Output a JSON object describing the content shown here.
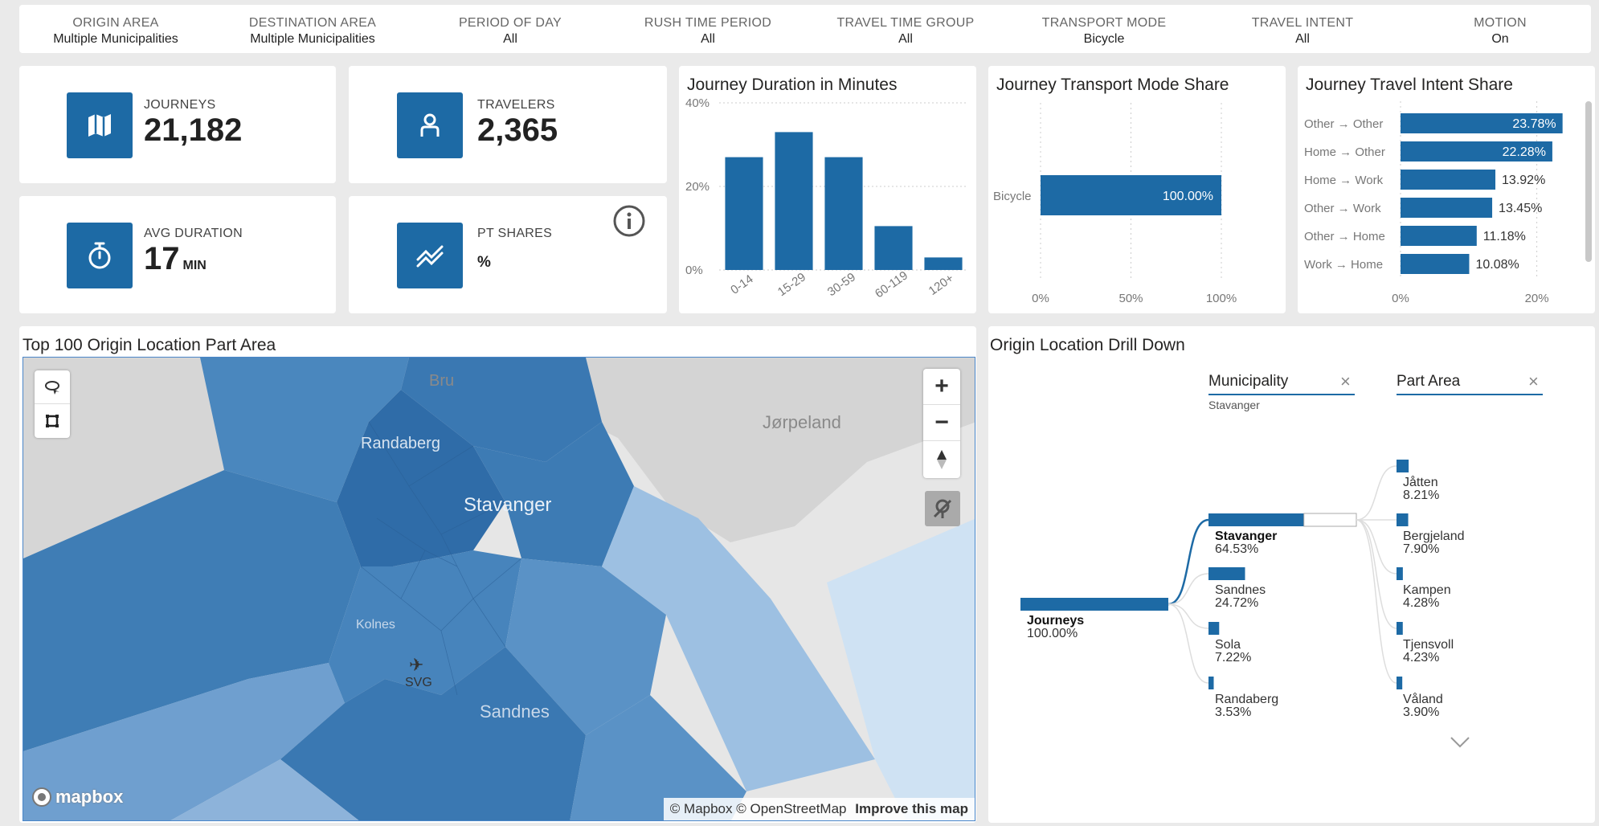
{
  "filters": [
    {
      "title": "ORIGIN AREA",
      "value": "Multiple Municipalities"
    },
    {
      "title": "DESTINATION AREA",
      "value": "Multiple Municipalities"
    },
    {
      "title": "PERIOD OF DAY",
      "value": "All"
    },
    {
      "title": "RUSH TIME PERIOD",
      "value": "All"
    },
    {
      "title": "TRAVEL TIME GROUP",
      "value": "All"
    },
    {
      "title": "TRANSPORT MODE",
      "value": "Bicycle"
    },
    {
      "title": "TRAVEL INTENT",
      "value": "All"
    },
    {
      "title": "MOTION",
      "value": "On"
    }
  ],
  "kpis": {
    "journeys": {
      "label": "JOURNEYS",
      "value": "21,182",
      "icon": "map-icon"
    },
    "travelers": {
      "label": "TRAVELERS",
      "value": "2,365",
      "icon": "person-icon"
    },
    "avg_duration": {
      "label": "AVG DURATION",
      "value": "17",
      "unit": "MIN",
      "icon": "stopwatch-icon"
    },
    "pt_shares": {
      "label": "PT SHARES",
      "value": "%",
      "icon": "trend-icon"
    }
  },
  "info_icon": "info-icon",
  "accent_color": "#1d6aa5",
  "chart_data": [
    {
      "type": "bar",
      "title": "Journey Duration in Minutes",
      "categories": [
        "0-14",
        "15-29",
        "30-59",
        "60-119",
        "120+"
      ],
      "values": [
        27,
        33,
        27,
        10.5,
        3
      ],
      "yticks": [
        "40%",
        "20%",
        "0%"
      ],
      "ylim": [
        0,
        40
      ]
    },
    {
      "type": "bar",
      "title": "Journey Transport Mode Share",
      "orientation": "horizontal",
      "categories": [
        "Bicycle"
      ],
      "values": [
        100.0
      ],
      "labels": [
        "100.00%"
      ],
      "xticks": [
        "0%",
        "50%",
        "100%"
      ],
      "xlim": [
        0,
        100
      ]
    },
    {
      "type": "bar",
      "title": "Journey Travel Intent Share",
      "orientation": "horizontal",
      "categories": [
        "Other → Other",
        "Home → Other",
        "Home → Work",
        "Other → Work",
        "Other → Home",
        "Work → Home"
      ],
      "values": [
        23.78,
        22.28,
        13.92,
        13.45,
        11.18,
        10.08
      ],
      "labels": [
        "23.78%",
        "22.28%",
        "13.92%",
        "13.45%",
        "11.18%",
        "10.08%"
      ],
      "xticks": [
        "0%",
        "20%"
      ],
      "xlim": [
        0,
        25
      ]
    }
  ],
  "map": {
    "title": "Top 100 Origin Location Part Area",
    "places": {
      "bru": "Bru",
      "jorpeland": "Jørpeland",
      "randaberg": "Randaberg",
      "stavanger": "Stavanger",
      "kolnes": "Kolnes",
      "svg": "SVG",
      "sandnes": "Sandnes"
    },
    "controls": {
      "zoom_in": "+",
      "zoom_out": "−",
      "compass": "compass-icon",
      "reset": "reset-icon",
      "lasso": "lasso-icon",
      "rect_select": "rect-select-icon"
    },
    "brand": "mapbox",
    "attribution": "© Mapbox © OpenStreetMap",
    "improve_link": "Improve this map"
  },
  "drill": {
    "title": "Origin Location Drill Down",
    "levels": [
      {
        "name": "Municipality",
        "selected": "Stavanger"
      },
      {
        "name": "Part Area",
        "selected": ""
      }
    ],
    "root": {
      "name": "Journeys",
      "pct": "100.00%",
      "value": 100.0
    },
    "municipalities": [
      {
        "name": "Stavanger",
        "pct": "64.53%",
        "value": 64.53
      },
      {
        "name": "Sandnes",
        "pct": "24.72%",
        "value": 24.72
      },
      {
        "name": "Sola",
        "pct": "7.22%",
        "value": 7.22
      },
      {
        "name": "Randaberg",
        "pct": "3.53%",
        "value": 3.53
      }
    ],
    "part_areas": [
      {
        "name": "Jåtten",
        "pct": "8.21%",
        "value": 8.21
      },
      {
        "name": "Bergjeland",
        "pct": "7.90%",
        "value": 7.9
      },
      {
        "name": "Kampen",
        "pct": "4.28%",
        "value": 4.28
      },
      {
        "name": "Tjensvoll",
        "pct": "4.23%",
        "value": 4.23
      },
      {
        "name": "Våland",
        "pct": "3.90%",
        "value": 3.9
      }
    ]
  }
}
